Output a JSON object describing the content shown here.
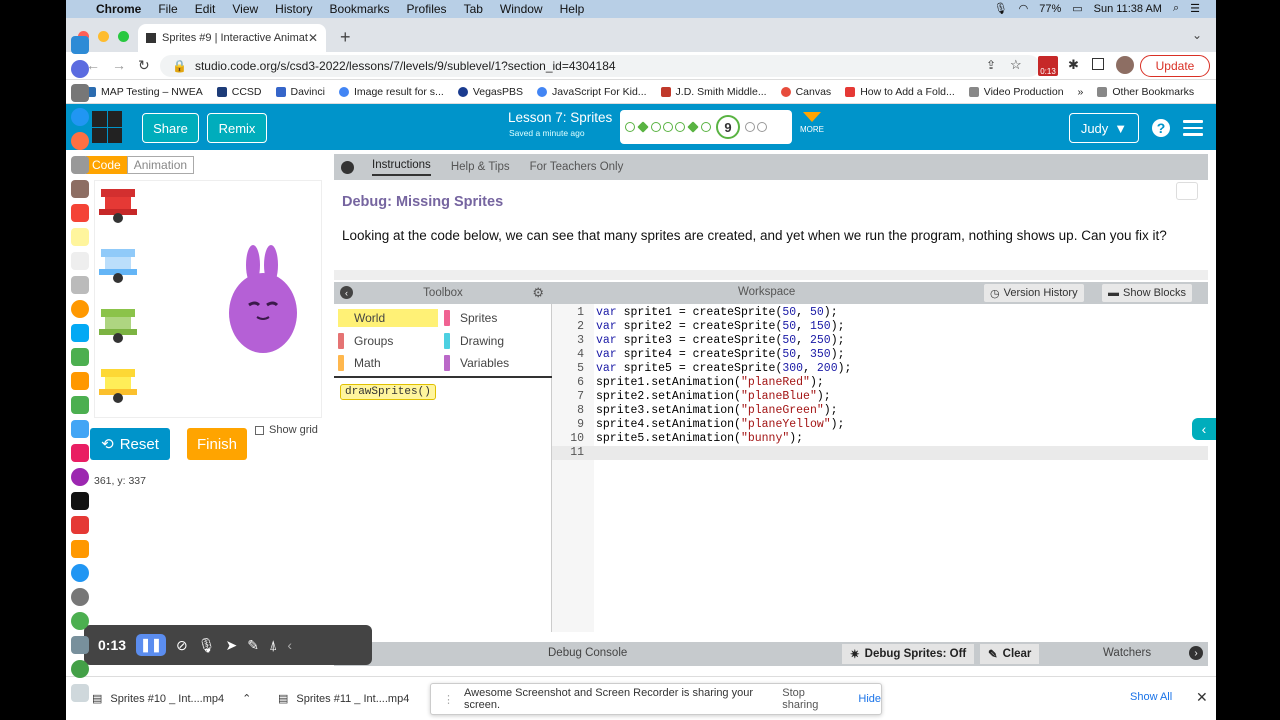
{
  "menubar": {
    "app": "Chrome",
    "items": [
      "File",
      "Edit",
      "View",
      "History",
      "Bookmarks",
      "Profiles",
      "Tab",
      "Window",
      "Help"
    ],
    "battery": "77%",
    "clock": "Sun 11:38 AM"
  },
  "tab": {
    "title": "Sprites #9 | Interactive Animat"
  },
  "address": {
    "url": "studio.code.org/s/csd3-2022/lessons/7/levels/9/sublevel/1?section_id=4304184",
    "update": "Update",
    "badge": "0:13"
  },
  "bookmarks": [
    {
      "label": "MAP Testing – NWEA",
      "color": "#2b6cb0"
    },
    {
      "label": "CCSD",
      "color": "#1d3c78"
    },
    {
      "label": "Davinci",
      "color": "#3565c9"
    },
    {
      "label": "Image result for s...",
      "color": "#4285f4"
    },
    {
      "label": "VegasPBS",
      "color": "#1a3b8f"
    },
    {
      "label": "JavaScript For Kid...",
      "color": "#4285f4"
    },
    {
      "label": "J.D. Smith Middle...",
      "color": "#c0392b"
    },
    {
      "label": "Canvas",
      "color": "#e74c3c"
    },
    {
      "label": "How to Add a Fold...",
      "color": "#e53935"
    },
    {
      "label": "Video Production",
      "color": "#888888"
    }
  ],
  "bookmarks_more": "»",
  "other_bookmarks": "Other Bookmarks",
  "header": {
    "share": "Share",
    "remix": "Remix",
    "lesson": "Lesson 7: Sprites",
    "saved": "Saved a minute ago",
    "current_level": "9",
    "more": "MORE",
    "user": "Judy"
  },
  "left": {
    "tab_code": "Code",
    "tab_animation": "Animation",
    "reset": "Reset",
    "finish": "Finish",
    "show_grid": "Show grid",
    "coords": "361,  y: 337"
  },
  "instructions": {
    "tabs": [
      "Instructions",
      "Help & Tips",
      "For Teachers Only"
    ],
    "title": "Debug: Missing Sprites",
    "body": "Looking at the code below, we can see that many sprites are created, and yet when we run the program, nothing shows up. Can you fix it?"
  },
  "toolbox": {
    "title": "Toolbox",
    "categories": [
      {
        "label": "World",
        "color": "#fff176"
      },
      {
        "label": "Sprites",
        "color": "#f06292"
      },
      {
        "label": "Groups",
        "color": "#e57373"
      },
      {
        "label": "Drawing",
        "color": "#4dd0e1"
      },
      {
        "label": "Math",
        "color": "#ffb74d"
      },
      {
        "label": "Variables",
        "color": "#ba68c8"
      }
    ],
    "block": "drawSprites()"
  },
  "workspace": {
    "title": "Workspace",
    "version_history": "Version History",
    "show_blocks": "Show Blocks",
    "lines": [
      "var sprite1 = createSprite(50, 50);",
      "var sprite2 = createSprite(50, 150);",
      "var sprite3 = createSprite(50, 250);",
      "var sprite4 = createSprite(50, 350);",
      "var sprite5 = createSprite(300, 200);",
      "sprite1.setAnimation(\"planeRed\");",
      "sprite2.setAnimation(\"planeBlue\");",
      "sprite3.setAnimation(\"planeGreen\");",
      "sprite4.setAnimation(\"planeYellow\");",
      "sprite5.setAnimation(\"bunny\");",
      ""
    ]
  },
  "debug": {
    "console": "Debug Console",
    "debug_sprites": "Debug Sprites: Off",
    "clear": "Clear",
    "watchers": "Watchers"
  },
  "recorder": {
    "time": "0:13"
  },
  "downloads": {
    "item1": "Sprites #10 _ Int....mp4",
    "item2": "Sprites #11 _ Int....mp4",
    "share_msg": "Awesome Screenshot and Screen Recorder is sharing your screen.",
    "stop": "Stop sharing",
    "hide": "Hide",
    "show_all": "Show All"
  }
}
